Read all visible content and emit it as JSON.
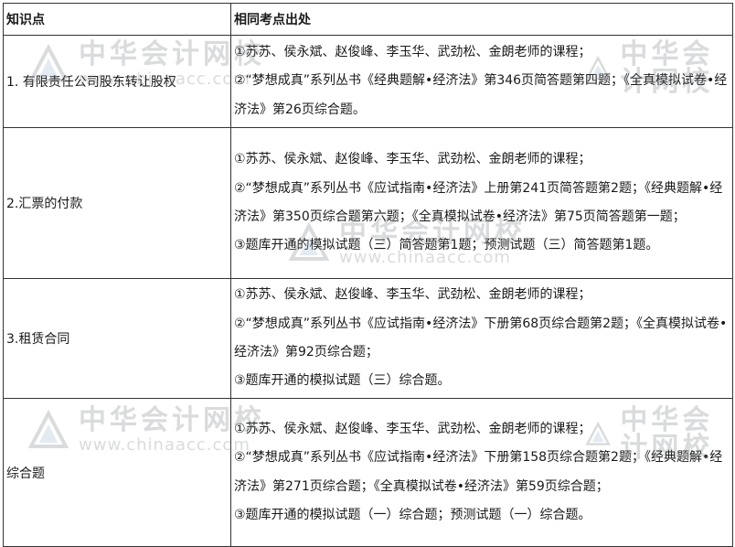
{
  "table": {
    "header": {
      "col1": "知识点",
      "col2": "相同考点出处"
    },
    "rows": [
      {
        "topic": "1. 有限责任公司股东转让股权",
        "lines": [
          "①苏苏、侯永斌、赵俊峰、李玉华、武劲松、金朗老师的课程；",
          "②“梦想成真”系列丛书《经典题解•经济法》第346页简答题第四题；《全真模拟试卷•经济法》第26页综合题。"
        ]
      },
      {
        "topic": "2.汇票的付款",
        "lines": [
          "①苏苏、侯永斌、赵俊峰、李玉华、武劲松、金朗老师的课程；",
          "②“梦想成真”系列丛书《应试指南•经济法》上册第241页简答题第2题；《经典题解•经济法》第350页综合题第六题；《全真模拟试卷•经济法》第75页简答题第一题；",
          "③题库开通的模拟试题（三）简答题第1题；预测试题（三）简答题第1题。"
        ]
      },
      {
        "topic": "3.租赁合同",
        "lines": [
          "①苏苏、侯永斌、赵俊峰、李玉华、武劲松、金朗老师的课程；",
          "②“梦想成真”系列丛书《应试指南•经济法》下册第68页综合题第2题；《全真模拟试卷•经济法》第92页综合题；",
          "③题库开通的模拟试题（三）综合题。"
        ]
      },
      {
        "topic": "综合题",
        "lines": [
          "①苏苏、侯永斌、赵俊峰、李玉华、武劲松、金朗老师的课程；",
          "②“梦想成真”系列丛书《应试指南•经济法》下册第158页综合题第2题；《经典题解•经济法》第271页综合题；《全真模拟试卷•经济法》第59页综合题；",
          "③题库开通的模拟试题（一）综合题；预测试题（一）综合题。"
        ]
      }
    ]
  },
  "watermark": {
    "cn": "中华会计网校",
    "en": "www.chinaacc.com",
    "color": "#7a7f86"
  }
}
